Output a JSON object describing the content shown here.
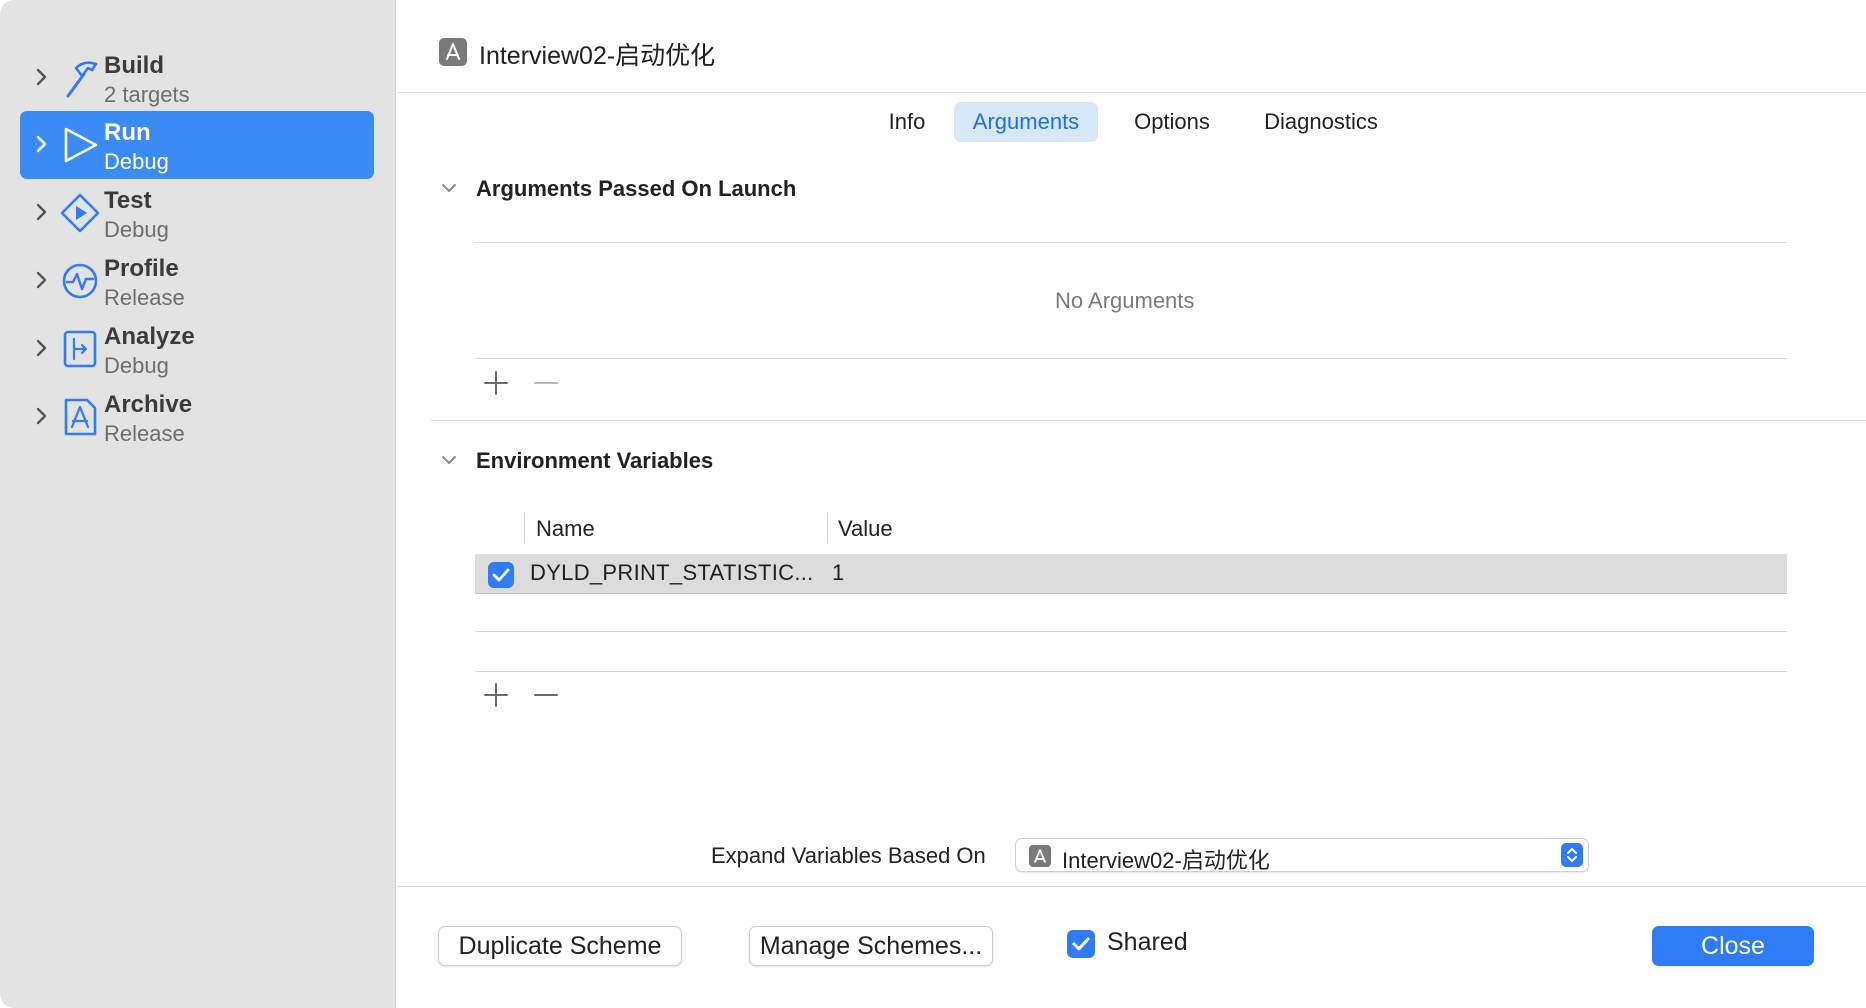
{
  "sidebar": {
    "items": [
      {
        "title": "Build",
        "subtitle": "2 targets",
        "icon": "hammer-icon"
      },
      {
        "title": "Run",
        "subtitle": "Debug",
        "icon": "play-outline-icon"
      },
      {
        "title": "Test",
        "subtitle": "Debug",
        "icon": "test-diamond-icon"
      },
      {
        "title": "Profile",
        "subtitle": "Release",
        "icon": "waveform-icon"
      },
      {
        "title": "Analyze",
        "subtitle": "Debug",
        "icon": "analyze-icon"
      },
      {
        "title": "Archive",
        "subtitle": "Release",
        "icon": "archive-icon"
      }
    ],
    "selected_index": 1
  },
  "header": {
    "title": "Interview02-启动优化",
    "icon": "app-icon"
  },
  "tabs": [
    {
      "label": "Info"
    },
    {
      "label": "Arguments"
    },
    {
      "label": "Options"
    },
    {
      "label": "Diagnostics"
    }
  ],
  "active_tab": "Arguments",
  "arguments_section": {
    "title": "Arguments Passed On Launch",
    "empty_text": "No Arguments"
  },
  "env_section": {
    "title": "Environment Variables",
    "columns": {
      "name": "Name",
      "value": "Value"
    },
    "rows": [
      {
        "enabled": true,
        "name": "DYLD_PRINT_STATISTIC...",
        "value": "1"
      }
    ]
  },
  "expand": {
    "label": "Expand Variables Based On",
    "value": "Interview02-启动优化"
  },
  "footer": {
    "duplicate_label": "Duplicate Scheme",
    "manage_label": "Manage Schemes...",
    "shared_label": "Shared",
    "shared_checked": true,
    "close_label": "Close"
  },
  "colors": {
    "accent": "#2f7cf6",
    "sidebar_bg": "#e3e3e3",
    "selected_row": "#3a8bf4",
    "active_tab_bg": "#d8e8fb"
  }
}
